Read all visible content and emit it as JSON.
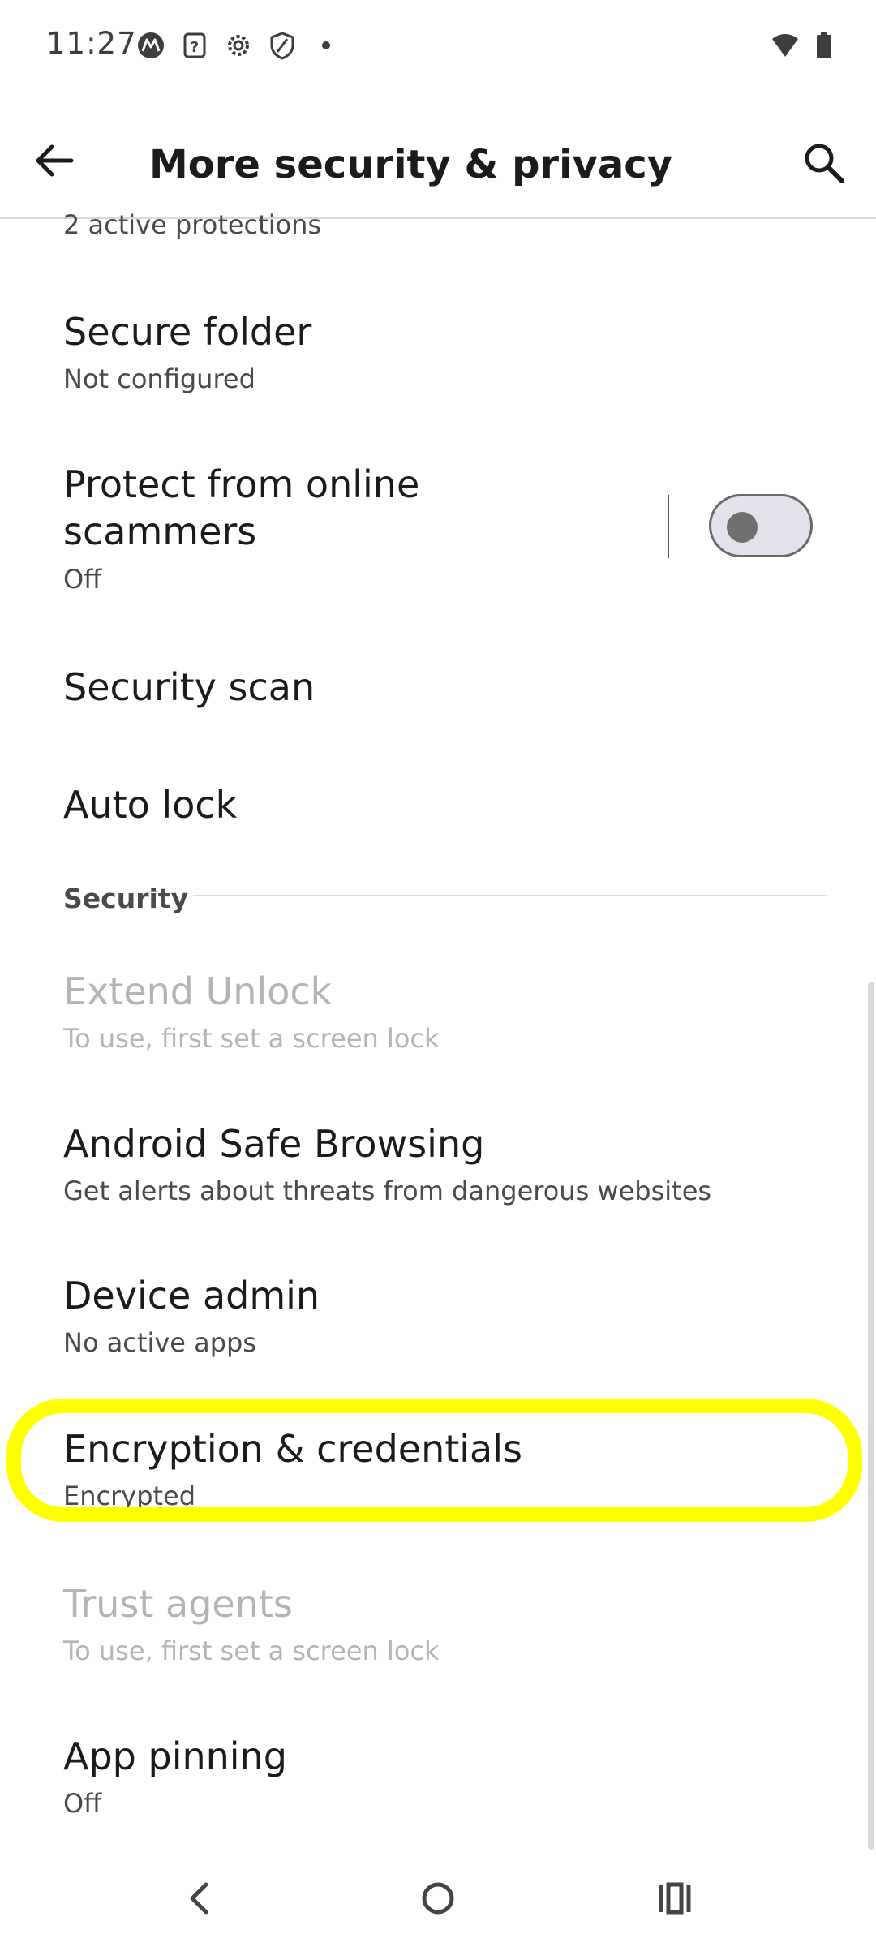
{
  "status_bar": {
    "time": "11:27",
    "icons": [
      "motorola-logo-icon",
      "help-icon",
      "settings-gear-icon",
      "shield-icon",
      "notification-dot-icon",
      "wifi-icon",
      "battery-icon"
    ]
  },
  "app_bar": {
    "back_icon": "arrow-back-icon",
    "title": "More security & privacy",
    "search_icon": "search-icon"
  },
  "list": {
    "partial_summary": "2 active protections",
    "secure_folder": {
      "title": "Secure folder",
      "summary": "Not configured"
    },
    "protect_scammers": {
      "title_line1": "Protect from online",
      "title_line2": "scammers",
      "summary": "Off",
      "toggle_on": false
    },
    "security_scan": {
      "title": "Security scan"
    },
    "auto_lock": {
      "title": "Auto lock"
    },
    "security_header": "Security",
    "extend_unlock": {
      "title": "Extend Unlock",
      "summary": "To use, first set a screen lock",
      "enabled": false
    },
    "safe_browsing": {
      "title": "Android Safe Browsing",
      "summary": "Get alerts about threats from dangerous websites"
    },
    "device_admin": {
      "title": "Device admin",
      "summary": "No active apps"
    },
    "encryption": {
      "title": "Encryption & credentials",
      "summary": "Encrypted",
      "highlighted": true
    },
    "trust_agents": {
      "title": "Trust agents",
      "summary": "To use, first set a screen lock",
      "enabled": false
    },
    "app_pinning": {
      "title": "App pinning",
      "summary": "Off"
    }
  },
  "colors": {
    "highlight": "#ffff00",
    "disabled_text": "#b4b4b4",
    "primary_text": "#1b1b1b"
  },
  "nav_bar": {
    "icons": [
      "nav-back-icon",
      "nav-home-icon",
      "nav-recents-icon"
    ]
  }
}
